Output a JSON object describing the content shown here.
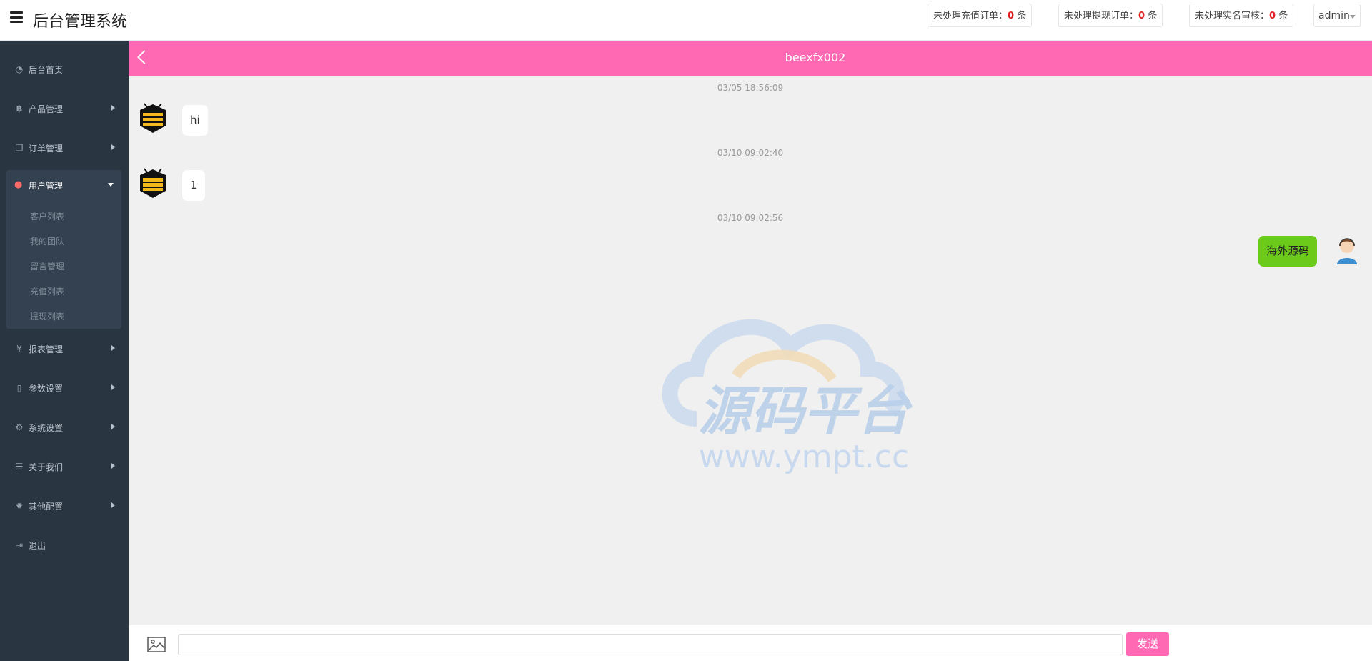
{
  "topbar": {
    "title": "后台管理系统",
    "stats": [
      {
        "label": "未处理充值订单：",
        "count": "0",
        "unit": "条"
      },
      {
        "label": "未处理提现订单：",
        "count": "0",
        "unit": "条"
      },
      {
        "label": "未处理实名审核：",
        "count": "0",
        "unit": "条"
      }
    ],
    "user": "admin"
  },
  "sidebar": {
    "items": [
      {
        "label": "后台首页",
        "icon": "dashboard-icon"
      },
      {
        "label": "产品管理",
        "icon": "bitcoin-icon"
      },
      {
        "label": "订单管理",
        "icon": "copy-icon"
      },
      {
        "label": "用户管理",
        "icon": "user-icon"
      },
      {
        "label": "报表管理",
        "icon": "yen-icon"
      },
      {
        "label": "参数设置",
        "icon": "file-icon"
      },
      {
        "label": "系统设置",
        "icon": "gears-icon"
      },
      {
        "label": "关于我们",
        "icon": "list-icon"
      },
      {
        "label": "其他配置",
        "icon": "gear-icon"
      },
      {
        "label": "退出",
        "icon": "sign-out-icon"
      }
    ],
    "submenu": [
      "客户列表",
      "我的团队",
      "留言管理",
      "充值列表",
      "提现列表"
    ]
  },
  "chat": {
    "title": "beexfx002",
    "messages": [
      {
        "time": "03/05 18:56:09",
        "text": "hi",
        "from": "user"
      },
      {
        "time": "03/10 09:02:40",
        "text": "1",
        "from": "user"
      },
      {
        "time": "03/10 09:02:56",
        "text": "海外源码",
        "from": "admin"
      }
    ]
  },
  "watermark": {
    "text": "源码平台",
    "url": "www.ympt.cc"
  },
  "input": {
    "placeholder": "",
    "send_label": "发送"
  },
  "colors": {
    "accent": "#ff69b4",
    "sidebar": "#2a3542",
    "my_bubble": "#6ccb1a",
    "alert": "#e02020"
  }
}
